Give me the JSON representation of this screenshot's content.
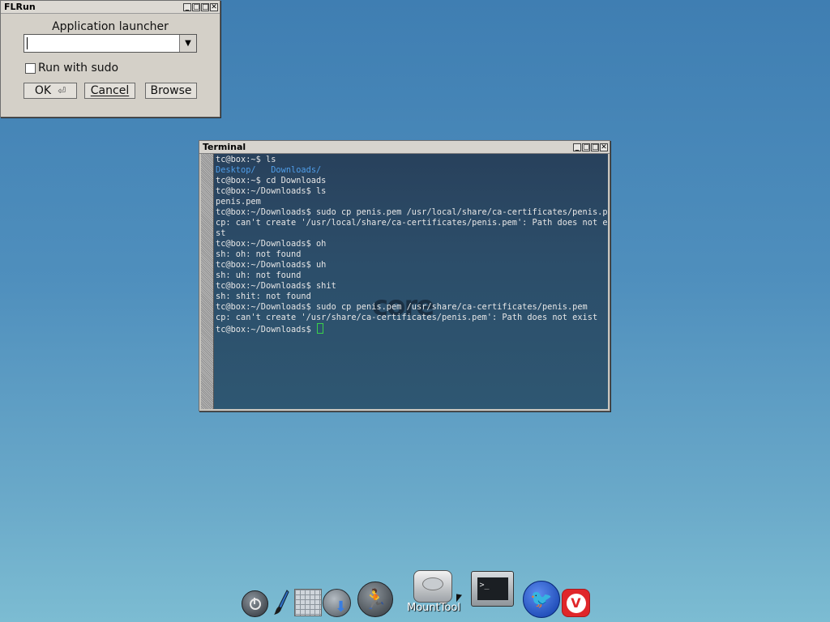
{
  "flrun": {
    "title": "FLRun",
    "heading": "Application launcher",
    "command_value": "",
    "sudo_label": "Run with sudo",
    "ok_label": "OK",
    "cancel_label": "Cancel",
    "browse_label": "Browse",
    "enter_glyph": "⏎",
    "dropdown_glyph": "▼"
  },
  "window_buttons": {
    "minimize": "_",
    "restore": "▢",
    "maximize": "□",
    "close": "✕"
  },
  "terminal": {
    "title": "Terminal",
    "logo_text": "core",
    "prompt": "tc@box:~/Downloads$ ",
    "lines": [
      "tc@box:~$ ls",
      "__DIRS__",
      "tc@box:~$ cd Downloads",
      "tc@box:~/Downloads$ ls",
      "penis.pem",
      "tc@box:~/Downloads$ sudo cp penis.pem /usr/local/share/ca-certificates/penis.pem",
      "cp: can't create '/usr/local/share/ca-certificates/penis.pem': Path does not exi",
      "st",
      "tc@box:~/Downloads$ oh",
      "sh: oh: not found",
      "tc@box:~/Downloads$ uh",
      "sh: uh: not found",
      "tc@box:~/Downloads$ shit",
      "sh: shit: not found",
      "tc@box:~/Downloads$ sudo cp penis.pem /usr/share/ca-certificates/penis.pem",
      "cp: can't create '/usr/share/ca-certificates/penis.pem': Path does not exist"
    ],
    "dirs": [
      "Desktop/",
      "Downloads/"
    ]
  },
  "dock": {
    "mount_label": "MountTool",
    "terminal_prompt": ">_",
    "run_glyph": "🏃",
    "seamonkey_glyph": "🐦",
    "vivaldi_glyph": "V"
  },
  "colors": {
    "desktop_top": "#3f7eb2",
    "desktop_bottom": "#7cbcd2",
    "dir_color": "#4f9de8",
    "cursor_color": "#3ad24a"
  }
}
